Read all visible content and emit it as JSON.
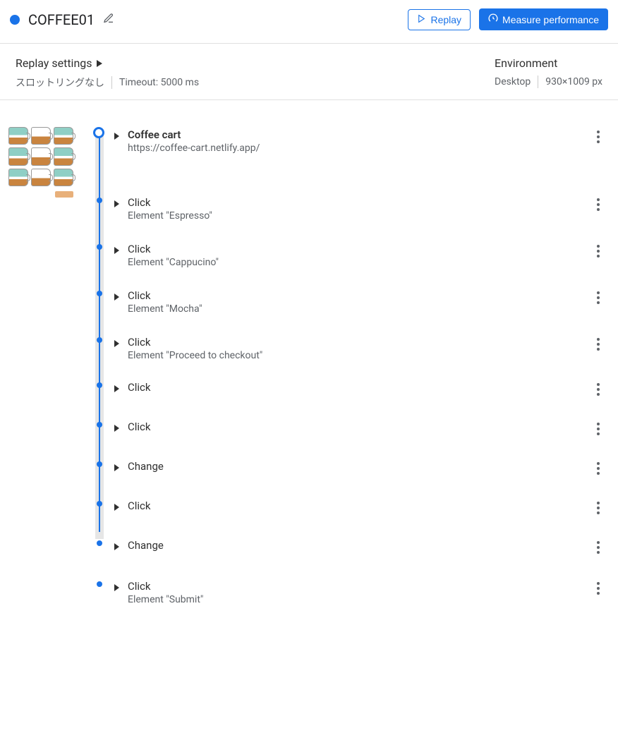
{
  "header": {
    "title": "COFFEE01",
    "replay_label": "Replay",
    "measure_label": "Measure performance"
  },
  "settings": {
    "heading": "Replay settings",
    "throttling": "スロットリングなし",
    "timeout": "Timeout: 5000 ms"
  },
  "environment": {
    "heading": "Environment",
    "device": "Desktop",
    "resolution": "930×1009 px"
  },
  "steps": [
    {
      "title": "Coffee cart",
      "sub": "https://coffee-cart.netlify.app/",
      "bold": true,
      "start": true
    },
    {
      "title": "Click",
      "sub": "Element \"Espresso\""
    },
    {
      "title": "Click",
      "sub": "Element \"Cappucino\""
    },
    {
      "title": "Click",
      "sub": "Element \"Mocha\""
    },
    {
      "title": "Click",
      "sub": "Element \"Proceed to checkout\""
    },
    {
      "title": "Click",
      "sub": ""
    },
    {
      "title": "Click",
      "sub": ""
    },
    {
      "title": "Change",
      "sub": ""
    },
    {
      "title": "Click",
      "sub": ""
    },
    {
      "title": "Change",
      "sub": ""
    },
    {
      "title": "Click",
      "sub": "Element \"Submit\""
    }
  ]
}
